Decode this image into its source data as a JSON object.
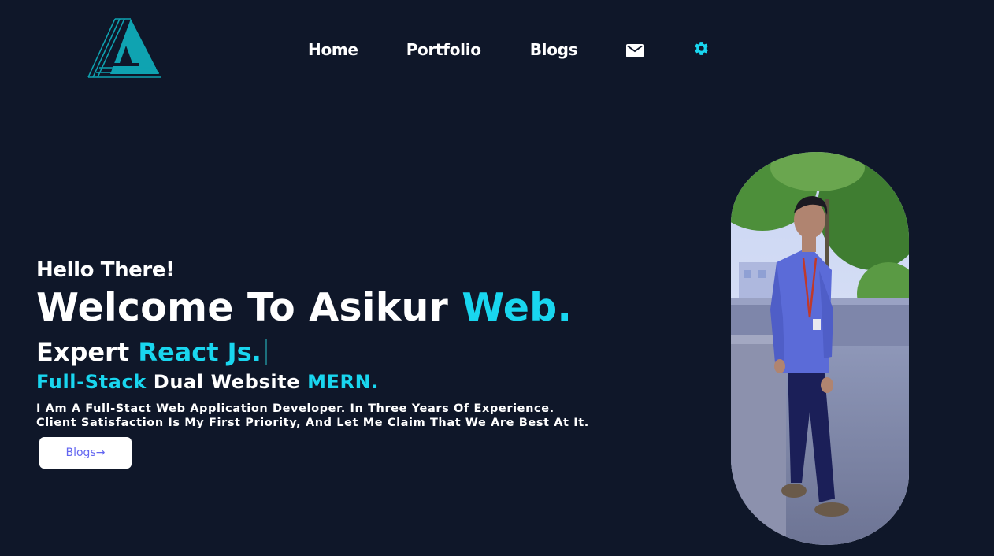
{
  "brand": {
    "logo_icon": "triangle-a-logo",
    "logo_letter": "A",
    "color": "#0fa3b1"
  },
  "nav": {
    "items": [
      {
        "label": "Home"
      },
      {
        "label": "Portfolio"
      },
      {
        "label": "Blogs"
      }
    ],
    "icons": [
      "envelope-icon",
      "gear-icon"
    ],
    "gear_color": "#19d6ef"
  },
  "hero": {
    "greeting": "Hello There!",
    "welcome_prefix": "Welcome To Asikur ",
    "welcome_accent": "Web.",
    "typing_prefix": "Expert ",
    "typing_accent": "React Js.",
    "line3_accent1": "Full-Stack",
    "line3_middle": " Dual Website ",
    "line3_accent2": "MERN.",
    "description_line1": "I Am A Full-Stact Web Application Developer. In Three Years Of Experience.",
    "description_line2": "Client Satisfaction Is My First Priority, And Let Me Claim That We Are Best At It.",
    "button_label": "Blogs→"
  },
  "colors": {
    "background": "#0f1729",
    "accent": "#19d6ef",
    "button_text": "#6366f1"
  }
}
